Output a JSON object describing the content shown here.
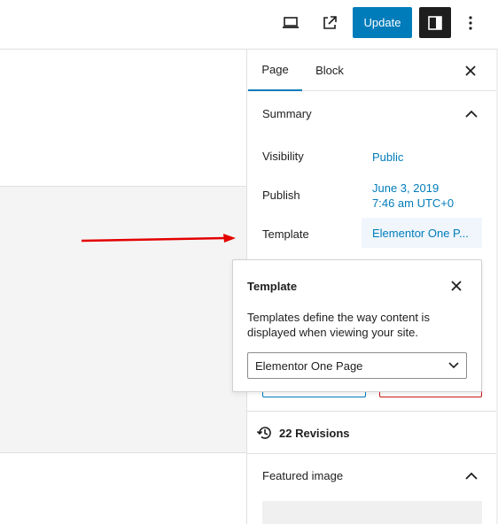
{
  "toolbar": {
    "update_label": "Update",
    "icons": [
      "desktop-preview-icon",
      "external-link-icon",
      "sidebar-toggle-icon",
      "more-options-icon"
    ]
  },
  "sidebar": {
    "tabs": [
      {
        "label": "Page"
      },
      {
        "label": "Block"
      }
    ],
    "summary": {
      "title": "Summary",
      "rows": [
        {
          "label": "Visibility",
          "value": "Public"
        },
        {
          "label": "Publish",
          "value_line1": "June 3, 2019",
          "value_line2": "7:46 am UTC+0"
        },
        {
          "label": "Template",
          "value": "Elementor One P..."
        }
      ]
    },
    "revisions": {
      "label": "22 Revisions"
    },
    "featured_image": {
      "title": "Featured image"
    }
  },
  "popover": {
    "title": "Template",
    "description": "Templates define the way content is displayed when viewing your site.",
    "select_value": "Elementor One Page"
  },
  "colors": {
    "accent": "#007cba",
    "arrow": "#e30000",
    "danger": "#cc1818"
  }
}
